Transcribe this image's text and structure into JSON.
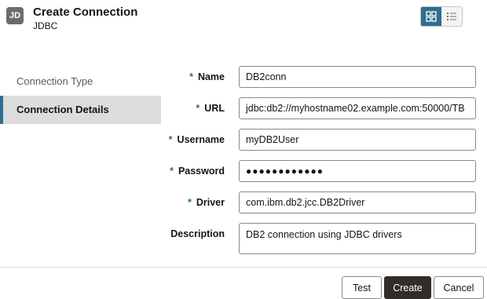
{
  "header": {
    "icon_text": "JD",
    "title": "Create Connection",
    "subtitle": "JDBC",
    "view_toggle": [
      "grid-view-icon",
      "list-view-icon"
    ]
  },
  "sidebar": {
    "items": [
      {
        "label": "Connection Type",
        "active": false
      },
      {
        "label": "Connection Details",
        "active": true
      }
    ]
  },
  "form": {
    "fields": [
      {
        "label": "Name",
        "required": true,
        "value": "DB2conn"
      },
      {
        "label": "URL",
        "required": true,
        "value": "jdbc:db2://myhostname02.example.com:50000/TB"
      },
      {
        "label": "Username",
        "required": true,
        "value": "myDB2User"
      },
      {
        "label": "Password",
        "required": true,
        "value": "●●●●●●●●●●●●"
      },
      {
        "label": "Driver",
        "required": true,
        "value": "com.ibm.db2.jcc.DB2Driver"
      },
      {
        "label": "Description",
        "required": false,
        "value": "DB2 connection using JDBC drivers"
      }
    ],
    "required_marker": "*"
  },
  "footer": {
    "test_label": "Test",
    "create_label": "Create",
    "cancel_label": "Cancel"
  },
  "colors": {
    "accent": "#2f6e8f",
    "primary_button": "#312d2a",
    "active_nav_bg": "#dcdcdc"
  }
}
